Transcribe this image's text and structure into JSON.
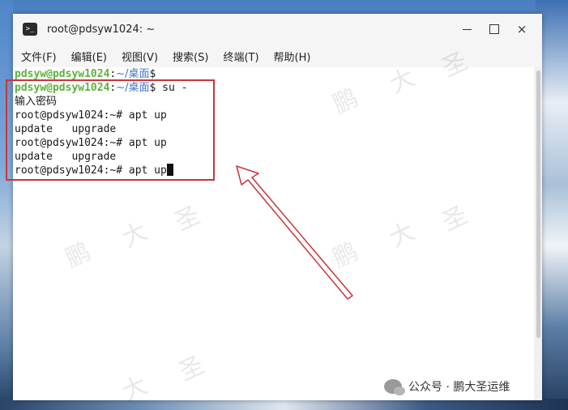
{
  "window": {
    "title": "root@pdsyw1024: ~",
    "icon_glyph": ">_",
    "controls": {
      "minimize": "minimize",
      "maximize": "maximize",
      "close": "×"
    }
  },
  "menu": [
    "文件(F)",
    "编辑(E)",
    "视图(V)",
    "搜索(S)",
    "终端(T)",
    "帮助(H)"
  ],
  "terminal": {
    "line0": {
      "user": "pdsyw@pdsyw1024",
      "colon": ":",
      "path": "~/桌面",
      "prompt": "$"
    },
    "line1": {
      "user": "pdsyw@pdsyw1024",
      "colon": ":",
      "path": "~/桌面",
      "prompt": "$",
      "cmd": " su -"
    },
    "line2": "输入密码",
    "line3": "root@pdsyw1024:~# apt up",
    "line4": "update   upgrade",
    "line5": "root@pdsyw1024:~# apt up",
    "line6": "update   upgrade",
    "line7": "root@pdsyw1024:~# apt up"
  },
  "annotation": {
    "box_color": "#c8353a",
    "arrow_color": "#c8353a"
  },
  "watermark": {
    "chars": [
      "鹏",
      "大",
      "圣"
    ]
  },
  "footer": {
    "credit": "公众号 · 鹏大圣运维",
    "icon": "wechat-icon"
  },
  "colors": {
    "user": "#5db33a",
    "path": "#3f74c9",
    "highlight": "#c8353a"
  }
}
